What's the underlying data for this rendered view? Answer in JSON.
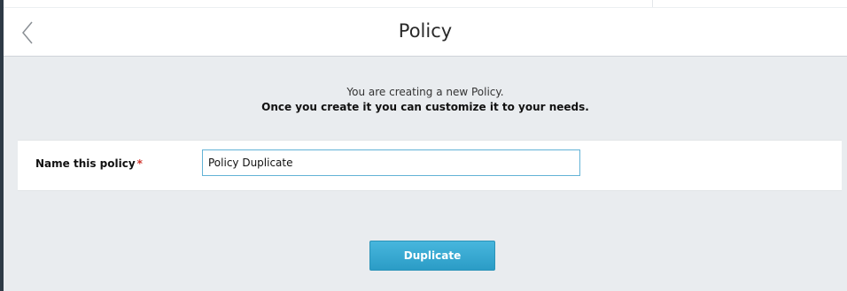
{
  "header": {
    "title": "Policy",
    "back_icon": "chevron-left-icon"
  },
  "intro": {
    "line1": "You are creating a new Policy.",
    "line2": "Once you create it you can customize it to your needs."
  },
  "form": {
    "name_label": "Name this policy",
    "required_marker": "*",
    "name_value": "Policy Duplicate",
    "input_border_color": "#63b3d6",
    "required_color": "#d0362f"
  },
  "actions": {
    "duplicate_label": "Duplicate",
    "button_color": "#2b9cc6"
  }
}
